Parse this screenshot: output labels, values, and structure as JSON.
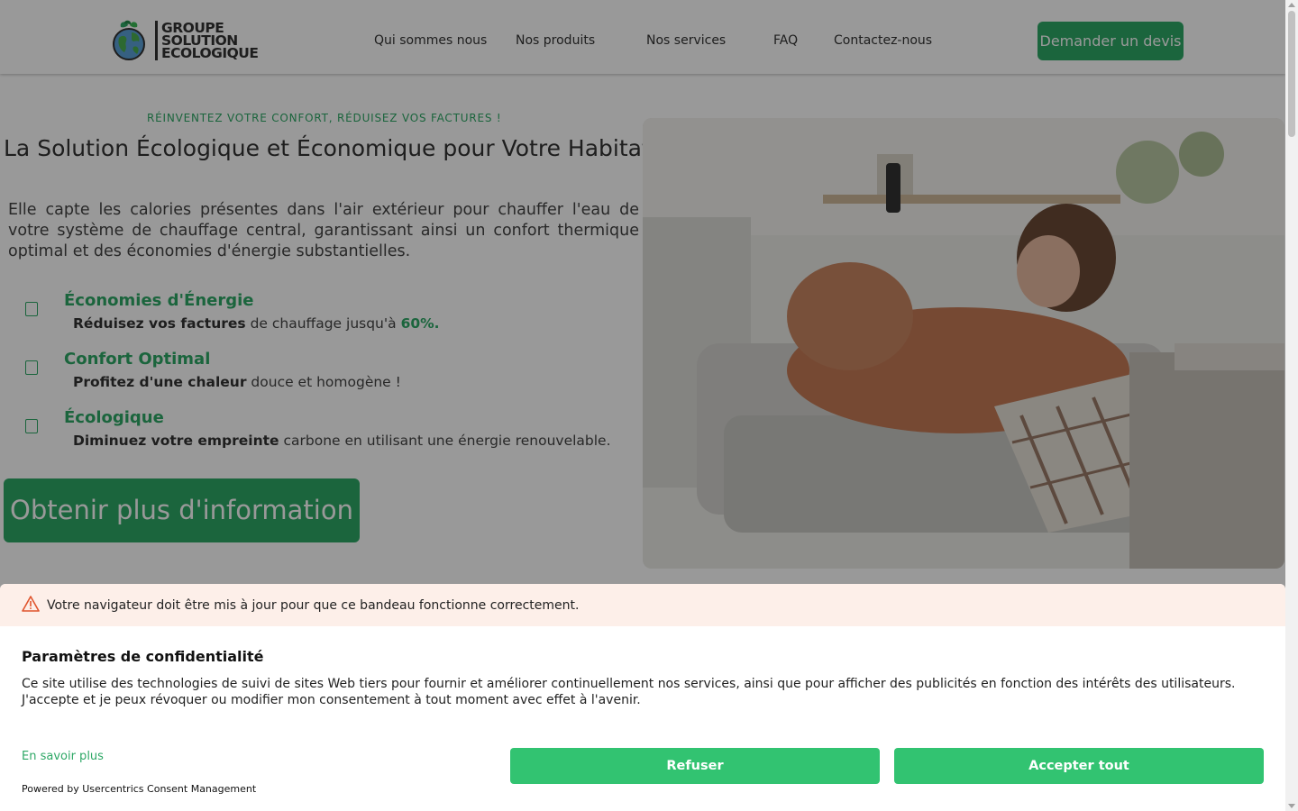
{
  "header": {
    "logo_text": [
      "GROUPE",
      "SOLUTION",
      "ECOLOGIQUE"
    ],
    "nav": [
      "Qui sommes nous",
      "Nos produits",
      "Nos services",
      "FAQ",
      "Contactez-nous"
    ],
    "cta": "Demander un devis"
  },
  "hero": {
    "tagline": "RÉINVENTEZ VOTRE CONFORT, RÉDUISEZ VOS FACTURES !",
    "title": "La Solution Écologique et Économique pour Votre Habitat !",
    "intro": "Elle capte les calories présentes dans l'air extérieur pour chauffer l'eau de votre système de chauffage central, garantissant ainsi un confort thermique optimal et des économies d'énergie substantielles.",
    "features": [
      {
        "title": "Économies d'Énergie",
        "bold": "Réduisez vos factures",
        "rest": " de chauffage jusqu'à ",
        "highlight": "60%."
      },
      {
        "title": "Confort Optimal",
        "bold": "Profitez d'une chaleur",
        "rest": " douce et homogène !",
        "highlight": ""
      },
      {
        "title": "Écologique",
        "bold": "Diminuez votre empreinte",
        "rest": " carbone en utilisant une énergie renouvelable.",
        "highlight": ""
      }
    ],
    "cta": "Obtenir plus d'information"
  },
  "consent": {
    "warning": "Votre navigateur doit être mis à jour pour que ce bandeau fonctionne correctement.",
    "title": "Paramètres de confidentialité",
    "text": "Ce site utilise des technologies de suivi de sites Web tiers pour fournir et améliorer continuellement nos services, ainsi que pour afficher des publicités en fonction des intérêts des utilisateurs. J'accepte et je peux révoquer ou modifier mon consentement à tout moment avec effet à l'avenir.",
    "learn_more": "En savoir plus",
    "powered_by": "Powered by Usercentrics Consent Management",
    "refuse": "Refuser",
    "accept": "Accepter tout"
  },
  "colors": {
    "brand_green": "#2ea866",
    "consent_green": "#32c371",
    "warning_bg": "#fdefe9"
  }
}
